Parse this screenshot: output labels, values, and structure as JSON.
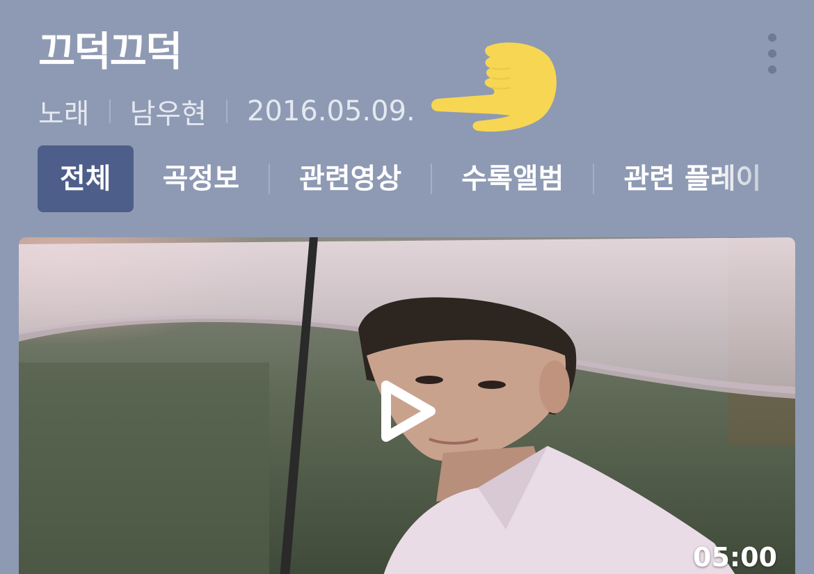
{
  "song": {
    "title": "끄덕끄덕",
    "type": "노래",
    "artist": "남우현",
    "date": "2016.05.09."
  },
  "tabs": [
    {
      "label": "전체",
      "active": true
    },
    {
      "label": "곡정보",
      "active": false
    },
    {
      "label": "관련영상",
      "active": false
    },
    {
      "label": "수록앨범",
      "active": false
    },
    {
      "label": "관련 플레이",
      "active": false
    }
  ],
  "video": {
    "duration": "05:00"
  },
  "icons": {
    "more": "more-vertical-icon",
    "play": "play-icon",
    "pointer": "pointing-hand-icon"
  },
  "colors": {
    "background": "#8e9ab3",
    "active_tab": "#4e5e8a",
    "hand": "#f7d653"
  }
}
